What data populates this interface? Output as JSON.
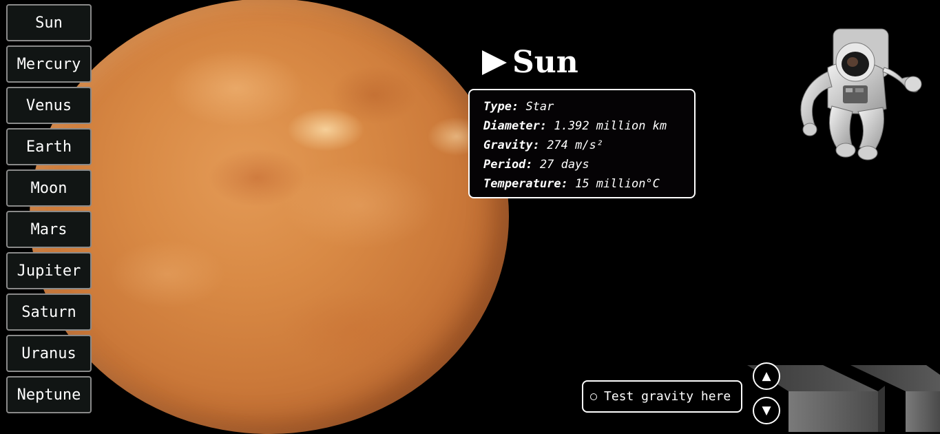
{
  "sidebar": {
    "items": [
      {
        "label": "Sun"
      },
      {
        "label": "Mercury"
      },
      {
        "label": "Venus"
      },
      {
        "label": "Earth"
      },
      {
        "label": "Moon"
      },
      {
        "label": "Mars"
      },
      {
        "label": "Jupiter"
      },
      {
        "label": "Saturn"
      },
      {
        "label": "Uranus"
      },
      {
        "label": "Neptune"
      }
    ]
  },
  "heading": {
    "icon": "play-triangle-icon",
    "title": "Sun"
  },
  "info": {
    "rows": [
      {
        "label": "Type:",
        "value": "Star"
      },
      {
        "label": "Diameter:",
        "value": "1.392 million km"
      },
      {
        "label": "Gravity:",
        "value": "274 m/s²"
      },
      {
        "label": "Period:",
        "value": "27 days"
      },
      {
        "label": "Temperature:",
        "value": "15 million°C"
      }
    ]
  },
  "controls": {
    "gravity_label": "Test gravity here",
    "up_icon": "▲",
    "down_icon": "▼"
  },
  "colors": {
    "background": "#000000",
    "sun": "#d98a45",
    "button_bg": "#111514"
  }
}
